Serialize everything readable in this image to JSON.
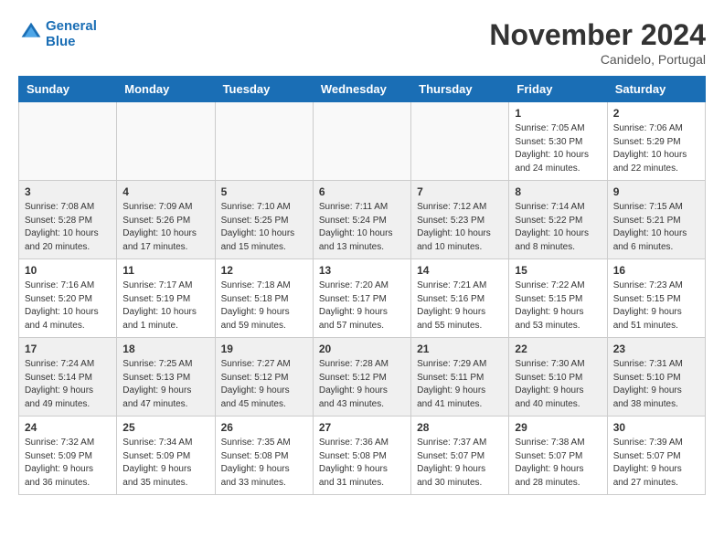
{
  "header": {
    "logo_line1": "General",
    "logo_line2": "Blue",
    "month": "November 2024",
    "location": "Canidelo, Portugal"
  },
  "weekdays": [
    "Sunday",
    "Monday",
    "Tuesday",
    "Wednesday",
    "Thursday",
    "Friday",
    "Saturday"
  ],
  "weeks": [
    {
      "shaded": false,
      "days": [
        {
          "num": "",
          "info": ""
        },
        {
          "num": "",
          "info": ""
        },
        {
          "num": "",
          "info": ""
        },
        {
          "num": "",
          "info": ""
        },
        {
          "num": "",
          "info": ""
        },
        {
          "num": "1",
          "info": "Sunrise: 7:05 AM\nSunset: 5:30 PM\nDaylight: 10 hours and 24 minutes."
        },
        {
          "num": "2",
          "info": "Sunrise: 7:06 AM\nSunset: 5:29 PM\nDaylight: 10 hours and 22 minutes."
        }
      ]
    },
    {
      "shaded": true,
      "days": [
        {
          "num": "3",
          "info": "Sunrise: 7:08 AM\nSunset: 5:28 PM\nDaylight: 10 hours and 20 minutes."
        },
        {
          "num": "4",
          "info": "Sunrise: 7:09 AM\nSunset: 5:26 PM\nDaylight: 10 hours and 17 minutes."
        },
        {
          "num": "5",
          "info": "Sunrise: 7:10 AM\nSunset: 5:25 PM\nDaylight: 10 hours and 15 minutes."
        },
        {
          "num": "6",
          "info": "Sunrise: 7:11 AM\nSunset: 5:24 PM\nDaylight: 10 hours and 13 minutes."
        },
        {
          "num": "7",
          "info": "Sunrise: 7:12 AM\nSunset: 5:23 PM\nDaylight: 10 hours and 10 minutes."
        },
        {
          "num": "8",
          "info": "Sunrise: 7:14 AM\nSunset: 5:22 PM\nDaylight: 10 hours and 8 minutes."
        },
        {
          "num": "9",
          "info": "Sunrise: 7:15 AM\nSunset: 5:21 PM\nDaylight: 10 hours and 6 minutes."
        }
      ]
    },
    {
      "shaded": false,
      "days": [
        {
          "num": "10",
          "info": "Sunrise: 7:16 AM\nSunset: 5:20 PM\nDaylight: 10 hours and 4 minutes."
        },
        {
          "num": "11",
          "info": "Sunrise: 7:17 AM\nSunset: 5:19 PM\nDaylight: 10 hours and 1 minute."
        },
        {
          "num": "12",
          "info": "Sunrise: 7:18 AM\nSunset: 5:18 PM\nDaylight: 9 hours and 59 minutes."
        },
        {
          "num": "13",
          "info": "Sunrise: 7:20 AM\nSunset: 5:17 PM\nDaylight: 9 hours and 57 minutes."
        },
        {
          "num": "14",
          "info": "Sunrise: 7:21 AM\nSunset: 5:16 PM\nDaylight: 9 hours and 55 minutes."
        },
        {
          "num": "15",
          "info": "Sunrise: 7:22 AM\nSunset: 5:15 PM\nDaylight: 9 hours and 53 minutes."
        },
        {
          "num": "16",
          "info": "Sunrise: 7:23 AM\nSunset: 5:15 PM\nDaylight: 9 hours and 51 minutes."
        }
      ]
    },
    {
      "shaded": true,
      "days": [
        {
          "num": "17",
          "info": "Sunrise: 7:24 AM\nSunset: 5:14 PM\nDaylight: 9 hours and 49 minutes."
        },
        {
          "num": "18",
          "info": "Sunrise: 7:25 AM\nSunset: 5:13 PM\nDaylight: 9 hours and 47 minutes."
        },
        {
          "num": "19",
          "info": "Sunrise: 7:27 AM\nSunset: 5:12 PM\nDaylight: 9 hours and 45 minutes."
        },
        {
          "num": "20",
          "info": "Sunrise: 7:28 AM\nSunset: 5:12 PM\nDaylight: 9 hours and 43 minutes."
        },
        {
          "num": "21",
          "info": "Sunrise: 7:29 AM\nSunset: 5:11 PM\nDaylight: 9 hours and 41 minutes."
        },
        {
          "num": "22",
          "info": "Sunrise: 7:30 AM\nSunset: 5:10 PM\nDaylight: 9 hours and 40 minutes."
        },
        {
          "num": "23",
          "info": "Sunrise: 7:31 AM\nSunset: 5:10 PM\nDaylight: 9 hours and 38 minutes."
        }
      ]
    },
    {
      "shaded": false,
      "days": [
        {
          "num": "24",
          "info": "Sunrise: 7:32 AM\nSunset: 5:09 PM\nDaylight: 9 hours and 36 minutes."
        },
        {
          "num": "25",
          "info": "Sunrise: 7:34 AM\nSunset: 5:09 PM\nDaylight: 9 hours and 35 minutes."
        },
        {
          "num": "26",
          "info": "Sunrise: 7:35 AM\nSunset: 5:08 PM\nDaylight: 9 hours and 33 minutes."
        },
        {
          "num": "27",
          "info": "Sunrise: 7:36 AM\nSunset: 5:08 PM\nDaylight: 9 hours and 31 minutes."
        },
        {
          "num": "28",
          "info": "Sunrise: 7:37 AM\nSunset: 5:07 PM\nDaylight: 9 hours and 30 minutes."
        },
        {
          "num": "29",
          "info": "Sunrise: 7:38 AM\nSunset: 5:07 PM\nDaylight: 9 hours and 28 minutes."
        },
        {
          "num": "30",
          "info": "Sunrise: 7:39 AM\nSunset: 5:07 PM\nDaylight: 9 hours and 27 minutes."
        }
      ]
    }
  ]
}
